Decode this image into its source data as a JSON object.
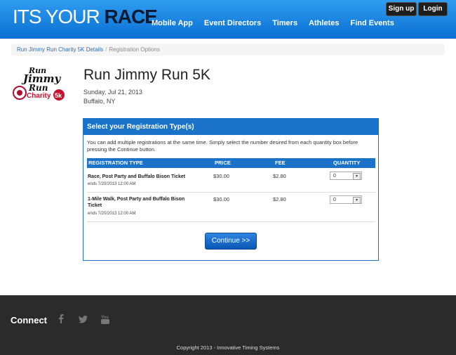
{
  "header": {
    "logo_prefix": "ITS YOUR ",
    "logo_race": "RACE",
    "nav": [
      "Mobile App",
      "Event Directors",
      "Timers",
      "Athletes",
      "Find Events"
    ],
    "signup_label": "Sign up",
    "login_label": "Login"
  },
  "breadcrumb": {
    "link": "Run Jimmy Run Charity 5K Details",
    "separator": "/",
    "current": "Registration Options"
  },
  "event": {
    "title": "Run Jimmy Run 5K",
    "date": "Sunday, Jul 21, 2013",
    "city": "Buffalo, NY",
    "logo_text_1": "Run",
    "logo_text_2": "Jimmy",
    "logo_text_3": "Run",
    "logo_text_4": "Charity",
    "logo_text_5": "5k"
  },
  "panel": {
    "heading": "Select your Registration Type(s)",
    "intro": "You can add multiple registrations at the same time. Simply select the number desired from each quantity box before pressing the Continue button.",
    "columns": [
      "REGISTRATION TYPE",
      "PRICE",
      "FEE",
      "QUANTITY"
    ],
    "rows": [
      {
        "name": "Race, Post Party and Buffalo Bison Ticket",
        "ends": "ends 7/20/2013 12:00 AM",
        "price": "$30.00",
        "fee": "$2.80",
        "qty": "0"
      },
      {
        "name": "1-Mile Walk, Post Party and Buffalo Bison Ticket",
        "ends": "ends 7/20/2013 12:00 AM",
        "price": "$30.00",
        "fee": "$2.80",
        "qty": "0"
      }
    ],
    "continue_label": "Continue >>"
  },
  "footer": {
    "connect": "Connect",
    "social_icons": [
      "facebook-icon",
      "twitter-icon",
      "youtube-icon"
    ],
    "copyright": "Copyright 2013 - Innovative Timing Systems"
  },
  "colors": {
    "header_blue": "#0a6fd1",
    "panel_blue": "#1a73c9",
    "footer_dark": "#2b2b2b"
  }
}
